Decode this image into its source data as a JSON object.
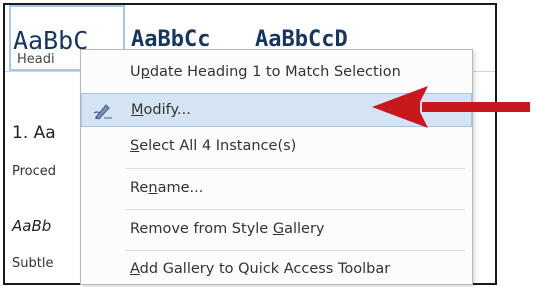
{
  "gallery": {
    "tile1_sample": "AaBbC",
    "tile1_name": "Headi",
    "tile2_sample": "AaBbCc",
    "tile3_sample": "AaBbCcD"
  },
  "document": {
    "line1": "1. Aa",
    "line2": "Proced",
    "line3": "AaBb",
    "line4": "Subtle"
  },
  "menu": {
    "items": [
      {
        "pre": "U",
        "ul": "p",
        "post": "date Heading 1 to Match Selection"
      },
      {
        "pre": "",
        "ul": "M",
        "post": "odify..."
      },
      {
        "pre": "",
        "ul": "S",
        "post": "elect All 4 Instance(s)"
      },
      {
        "pre": "Re",
        "ul": "n",
        "post": "ame..."
      },
      {
        "pre": "Remove from Style ",
        "ul": "G",
        "post": "allery"
      },
      {
        "pre": "",
        "ul": "A",
        "post": "dd Gallery to Quick Access Toolbar"
      }
    ],
    "modify_icon": "pencil-style-icon"
  },
  "annotation": {
    "arrow": "red-arrow-icon",
    "arrow_color": "#c8181e"
  },
  "colors": {
    "highlight_bg": "#d5e4f5",
    "highlight_border": "#a7c4e6",
    "heading_text": "#17365d"
  }
}
